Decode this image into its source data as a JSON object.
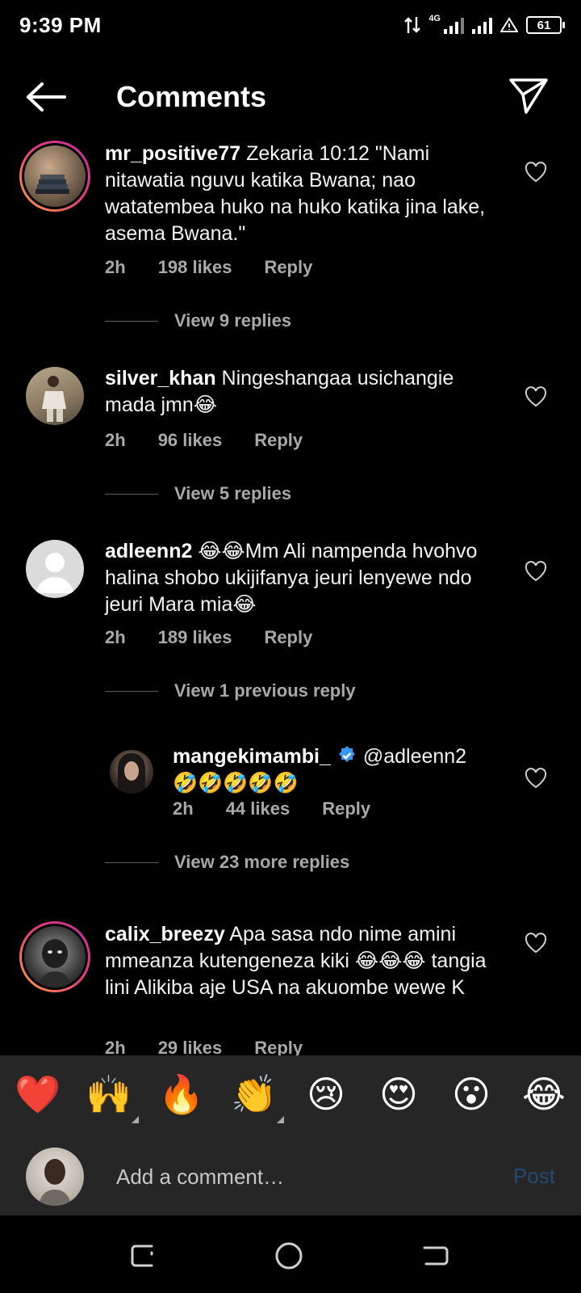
{
  "status": {
    "time": "9:39 PM",
    "network": "4G",
    "battery": "61"
  },
  "header": {
    "title": "Comments"
  },
  "comments": [
    {
      "username": "mr_positive77",
      "text": "Zekaria 10:12 \"Nami nitawatia nguvu katika Bwana; nao watatembea huko na huko katika jina lake, asema Bwana.\"",
      "time": "2h",
      "likes": "198 likes",
      "reply": "Reply",
      "view_replies": "View 9 replies"
    },
    {
      "username": "silver_khan",
      "text": "Ningeshangaa usichangie mada jmn😂",
      "time": "2h",
      "likes": "96 likes",
      "reply": "Reply",
      "view_replies": "View 5 replies"
    },
    {
      "username": "adleenn2",
      "text": "😂😂Mm Ali nampenda hvohvo halina shobo ukijifanya jeuri lenyewe ndo jeuri Mara mia😂",
      "time": "2h",
      "likes": "189 likes",
      "reply": "Reply",
      "view_replies": "View 1 previous reply"
    },
    {
      "username": "mangekimambi_",
      "text": "@adleenn2 🤣🤣🤣🤣🤣",
      "time": "2h",
      "likes": "44 likes",
      "reply": "Reply",
      "view_replies": "View 23 more replies"
    },
    {
      "username": "calix_breezy",
      "text": "Apa sasa ndo nime amini mmeanza kutengeneza kiki 😂😂😂 tangia lini Alikiba aje USA na akuombe wewe K",
      "time": "2h",
      "likes": "29 likes",
      "reply": "Reply"
    }
  ],
  "reactions": [
    "❤️",
    "🙌",
    "🔥",
    "👏",
    "😢",
    "😍",
    "😮",
    "😂"
  ],
  "composer": {
    "placeholder": "Add a comment…",
    "post_label": "Post"
  },
  "colors": {
    "background": "#000000",
    "panel": "#262626",
    "meta_text": "#a8a8a8",
    "post_disabled": "#224a73",
    "verified": "#3897f0"
  }
}
